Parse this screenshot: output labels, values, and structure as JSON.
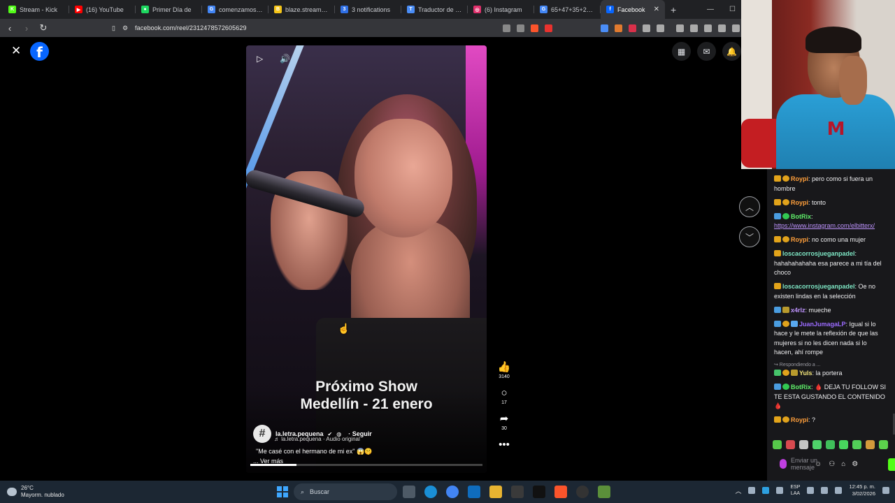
{
  "browser": {
    "tabs": [
      {
        "label": "Stream - Kick",
        "color": "#53fc18",
        "glyph": "K"
      },
      {
        "label": "(16) YouTube",
        "color": "#ff0000",
        "glyph": "▶"
      },
      {
        "label": "Primer Día de",
        "color": "#1ed760",
        "glyph": "●"
      },
      {
        "label": "comenzamos de",
        "color": "#4285f4",
        "glyph": "G"
      },
      {
        "label": "blaze.stream/stre",
        "color": "#f5c518",
        "glyph": "B"
      },
      {
        "label": "3 notifications",
        "color": "#2f6fe4",
        "glyph": "3"
      },
      {
        "label": "Traductor de Goo",
        "color": "#4a8df6",
        "glyph": "T"
      },
      {
        "label": "(6) Instagram",
        "color": "#e1306c",
        "glyph": "◎"
      },
      {
        "label": "65+47+35+23+1",
        "color": "#4285f4",
        "glyph": "G"
      }
    ],
    "active_tab": {
      "label": "Facebook",
      "color": "#0866ff",
      "glyph": "f"
    },
    "url": "facebook.com/reel/2312478572605629",
    "window_controls": {
      "minimize": "—",
      "maximize": "☐",
      "overflow": "F"
    }
  },
  "reel": {
    "caption_line1": "Próximo Show",
    "caption_line2": "Medellín - 21 enero",
    "author": "la.letra.pequena",
    "follow_label": "· Seguir",
    "audio": "♬ la.letra.pequena · Audio original",
    "description": "\"Me casé con el hermano de mi ex\" 😱🤫",
    "more_label": "... Ver más",
    "avatar_glyph": "#",
    "progress": 0.2,
    "likes": "3140",
    "comments": "17",
    "shares": "30"
  },
  "chat": {
    "messages": [
      {
        "badges": [
          "crown",
          "coin"
        ],
        "user": "Roypi",
        "color": "#ff9f3b",
        "text": ": pero como si fuera un hombre"
      },
      {
        "badges": [
          "crown",
          "coin"
        ],
        "user": "Roypi",
        "color": "#ff9f3b",
        "text": ": tonto"
      },
      {
        "badges": [
          "bot",
          "ver"
        ],
        "user": "BotRix",
        "color": "#5ff06a",
        "text": ":",
        "link": "https://www.instagram.com/elbitterx/"
      },
      {
        "badges": [
          "crown",
          "coin"
        ],
        "user": "Roypi",
        "color": "#ff9f3b",
        "text": ": no como una mujer"
      },
      {
        "badges": [
          "crown"
        ],
        "user": "loscacorrosjueganpadel",
        "color": "#7ee7c5",
        "text": ": hahahahahaha esa parece a mi tía del choco"
      },
      {
        "badges": [
          "crown"
        ],
        "user": "loscacorrosjueganpadel",
        "color": "#7ee7c5",
        "text": ": Oe no existen lindas en la selección"
      },
      {
        "badges": [
          "bot",
          "cup"
        ],
        "user": "x4rlz",
        "color": "#bf94ff",
        "text": ": mueche"
      },
      {
        "badges": [
          "bot",
          "coin",
          "tier"
        ],
        "user": "JuanJumagaLP",
        "color": "#9b6bff",
        "text": ": Igual si lo hace y le mete la reflexión de que las mujeres si no les dicen nada si lo hacen, ahí rompe"
      },
      {
        "reply": "↪ Respondiendo a ...",
        "badges": [
          "green",
          "coin",
          "cup"
        ],
        "user": "Yuls",
        "color": "#f3e57a",
        "text": ": la portera"
      },
      {
        "badges": [
          "bot",
          "ver"
        ],
        "user": "BotRix",
        "color": "#5ff06a",
        "text": ": 🩸 DEJA TU FOLLOW SI TE ESTA GUSTANDO EL CONTENIDO 🩸"
      },
      {
        "badges": [
          "crown",
          "coin"
        ],
        "user": "Roypi",
        "color": "#ff9f3b",
        "text": ": ?"
      }
    ],
    "input_placeholder": "Enviar un mensaje"
  },
  "taskbar": {
    "temperature": "26°C",
    "weather": "Mayorm. nublado",
    "search_placeholder": "Buscar",
    "lang_line1": "ESP",
    "lang_line2": "LAA",
    "time": "12:45 p. m.",
    "date": "3/02/2026"
  }
}
